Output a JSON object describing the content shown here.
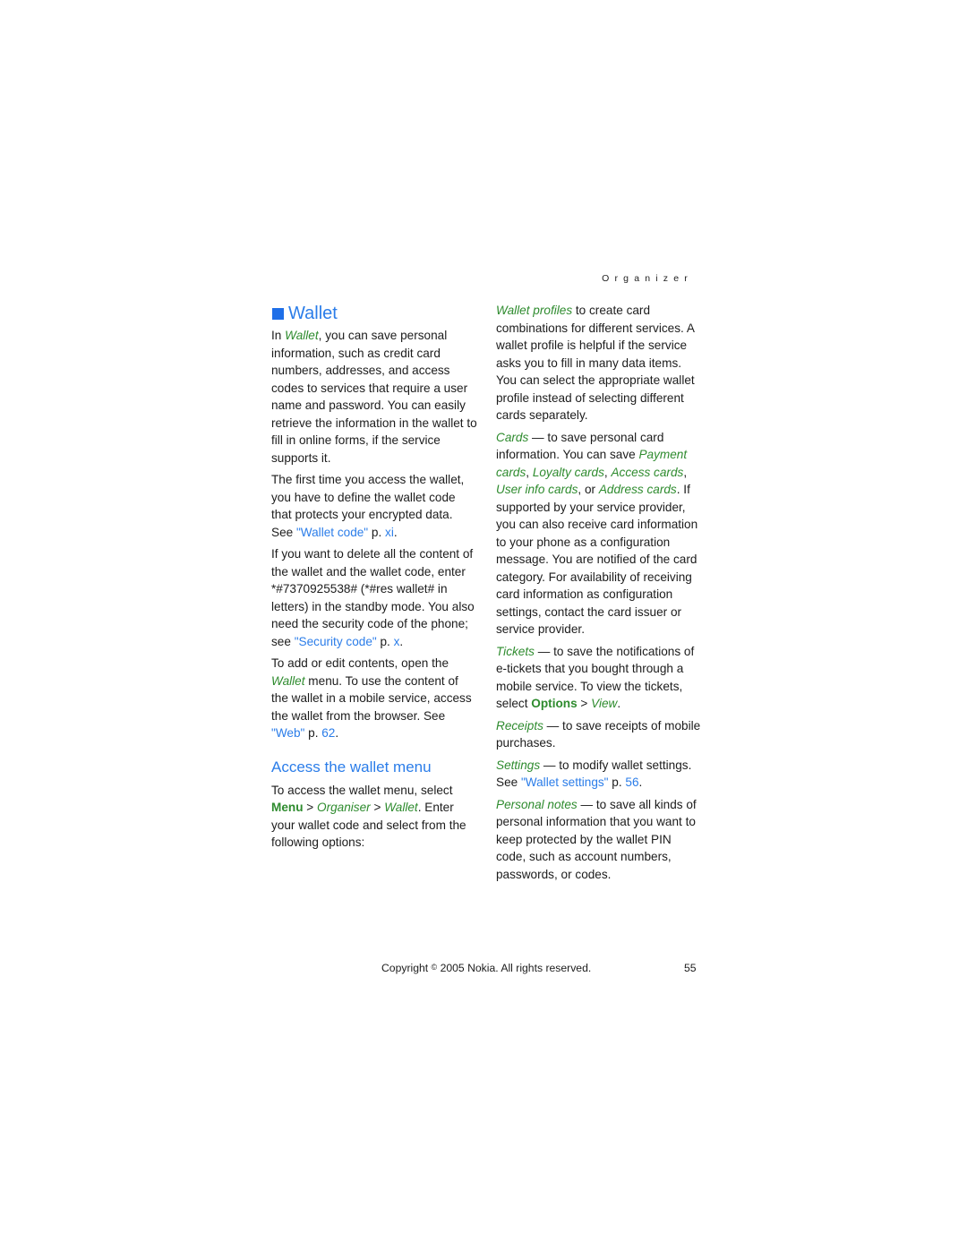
{
  "header": {
    "section": "Organizer"
  },
  "left_column": {
    "title": "Wallet",
    "intro": {
      "pre": "In ",
      "italic": "Wallet",
      "post": ", you can save personal information, such as credit card numbers, addresses, and access codes to services that require a user name and password. You can easily retrieve the information in the wallet to fill in online forms, if the service supports it."
    },
    "first_time": {
      "text": "The first time you access the wallet, you have to define the wallet code that protects your encrypted data. See ",
      "link": "\"Wallet code\"",
      "page_prefix": " p. ",
      "page": "xi",
      "end": "."
    },
    "delete": {
      "text": "If you want to delete all the content of the wallet and the wallet code, enter *#7370925538# (*#res wallet# in letters) in the standby mode. You also need the security code of the phone; see ",
      "link": "\"Security code\"",
      "page_prefix": " p. ",
      "page": "x",
      "end": "."
    },
    "add_edit": {
      "pre": "To add or edit contents, open the ",
      "italic": "Wallet",
      "post": " menu. To use the content of the wallet in a mobile service, access the wallet from the browser. See ",
      "link": "\"Web\"",
      "page_prefix": " p. ",
      "page": "62",
      "end": "."
    },
    "subtitle": "Access the wallet menu",
    "access": {
      "pre": "To access the wallet menu, select ",
      "menu": "Menu",
      "sep1": " > ",
      "organiser": "Organiser",
      "sep2": " > ",
      "wallet": "Wallet",
      "post": ". Enter your wallet code and select from the following options:"
    }
  },
  "right_column": {
    "wallet_profiles": {
      "term": "Wallet profiles",
      "text": " to create card combinations for different services. A wallet profile is helpful if the service asks you to fill in many data items. You can select the appropriate wallet profile instead of selecting different cards separately."
    },
    "cards": {
      "term": "Cards",
      "text1": " — to save personal card information. You can save ",
      "payment": "Payment cards",
      "c1": ", ",
      "loyalty": "Loyalty cards",
      "c2": ", ",
      "access": "Access cards",
      "c3": ", ",
      "userinfo": "User info cards",
      "c4": ", or ",
      "address": "Address cards",
      "text2": ". If supported by your service provider, you can also receive card information to your phone as a configuration message. You are notified of the card category. For availability of receiving card information as configuration settings, contact the card issuer or service provider."
    },
    "tickets": {
      "term": "Tickets",
      "text": " — to save the notifications of e-tickets that you bought through a mobile service. To view the tickets, select ",
      "options": "Options",
      "sep": " > ",
      "view": "View",
      "end": "."
    },
    "receipts": {
      "term": "Receipts",
      "text": " — to save receipts of mobile purchases."
    },
    "settings": {
      "term": "Settings",
      "text": " — to modify wallet settings. See ",
      "link": "\"Wallet settings\"",
      "page_prefix": " p. ",
      "page": "56",
      "end": "."
    },
    "personal_notes": {
      "term": "Personal notes",
      "text": " — to save all kinds of personal information that you want to keep protected by the wallet PIN code, such as account numbers, passwords, or codes."
    }
  },
  "footer": {
    "copyright_pre": "Copyright ",
    "copyright_symbol": "©",
    "copyright_post": " 2005 Nokia. All rights reserved.",
    "page_number": "55"
  },
  "colors": {
    "heading_blue": "#2b7de9",
    "term_green": "#2e8b2e",
    "link_blue": "#2b7de9",
    "text": "#1c1c1c"
  }
}
